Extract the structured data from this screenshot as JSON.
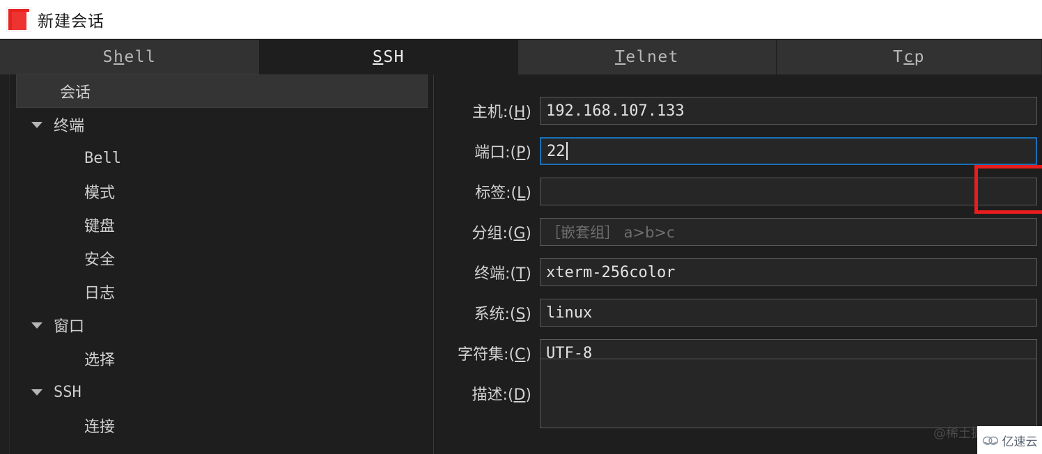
{
  "window": {
    "title": "新建会话",
    "logo_icon": "app-logo-icon",
    "accent_color": "#e8221f"
  },
  "tabs": [
    {
      "label": "Shell",
      "pre": "S",
      "accel": "h",
      "post": "ell",
      "active": false
    },
    {
      "label": "SSH",
      "pre": "",
      "accel": "S",
      "post": "SH",
      "active": true
    },
    {
      "label": "Telnet",
      "pre": "",
      "accel": "T",
      "post": "elnet",
      "active": false
    },
    {
      "label": "Tcp",
      "pre": "T",
      "accel": "c",
      "post": "p",
      "active": false
    }
  ],
  "sidebar": {
    "items": [
      {
        "label": "会话",
        "level": 0,
        "expandable": false,
        "selected": true,
        "mono": false
      },
      {
        "label": "终端",
        "level": 0,
        "expandable": true,
        "selected": false,
        "mono": false
      },
      {
        "label": "Bell",
        "level": 1,
        "expandable": false,
        "selected": false,
        "mono": true
      },
      {
        "label": "模式",
        "level": 1,
        "expandable": false,
        "selected": false,
        "mono": false
      },
      {
        "label": "键盘",
        "level": 1,
        "expandable": false,
        "selected": false,
        "mono": false
      },
      {
        "label": "安全",
        "level": 1,
        "expandable": false,
        "selected": false,
        "mono": false
      },
      {
        "label": "日志",
        "level": 1,
        "expandable": false,
        "selected": false,
        "mono": false
      },
      {
        "label": "窗口",
        "level": 0,
        "expandable": true,
        "selected": false,
        "mono": false
      },
      {
        "label": "选择",
        "level": 1,
        "expandable": false,
        "selected": false,
        "mono": false
      },
      {
        "label": "SSH",
        "level": 0,
        "expandable": true,
        "selected": false,
        "mono": true
      },
      {
        "label": "连接",
        "level": 1,
        "expandable": false,
        "selected": false,
        "mono": false
      }
    ]
  },
  "form": {
    "fields": [
      {
        "label_pre": "主机:(",
        "accel": "H",
        "label_post": ")",
        "value": "192.168.107.133",
        "placeholder": "",
        "focused": false,
        "highlighted": true,
        "multiline": false
      },
      {
        "label_pre": "端口:(",
        "accel": "P",
        "label_post": ")",
        "value": "22",
        "placeholder": "",
        "focused": true,
        "highlighted": false,
        "multiline": false
      },
      {
        "label_pre": "标签:(",
        "accel": "L",
        "label_post": ")",
        "value": "",
        "placeholder": "",
        "focused": false,
        "highlighted": false,
        "multiline": false
      },
      {
        "label_pre": "分组:(",
        "accel": "G",
        "label_post": ")",
        "value": "",
        "placeholder": "［嵌套组］ a>b>c",
        "focused": false,
        "highlighted": false,
        "multiline": false
      },
      {
        "label_pre": "终端:(",
        "accel": "T",
        "label_post": ")",
        "value": "xterm-256color",
        "placeholder": "",
        "focused": false,
        "highlighted": false,
        "multiline": false
      },
      {
        "label_pre": "系统:(",
        "accel": "S",
        "label_post": ")",
        "value": "linux",
        "placeholder": "",
        "focused": false,
        "highlighted": false,
        "multiline": false
      },
      {
        "label_pre": "字符集:(",
        "accel": "C",
        "label_post": ")",
        "value": "UTF-8",
        "placeholder": "",
        "focused": false,
        "highlighted": false,
        "multiline": false
      },
      {
        "label_pre": "描述:(",
        "accel": "D",
        "label_post": ")",
        "value": "",
        "placeholder": "",
        "focused": false,
        "highlighted": false,
        "multiline": true
      }
    ]
  },
  "watermarks": {
    "author": "@稀土掘金",
    "badge_text": "亿速云",
    "badge_icon": "cloud-icon"
  }
}
